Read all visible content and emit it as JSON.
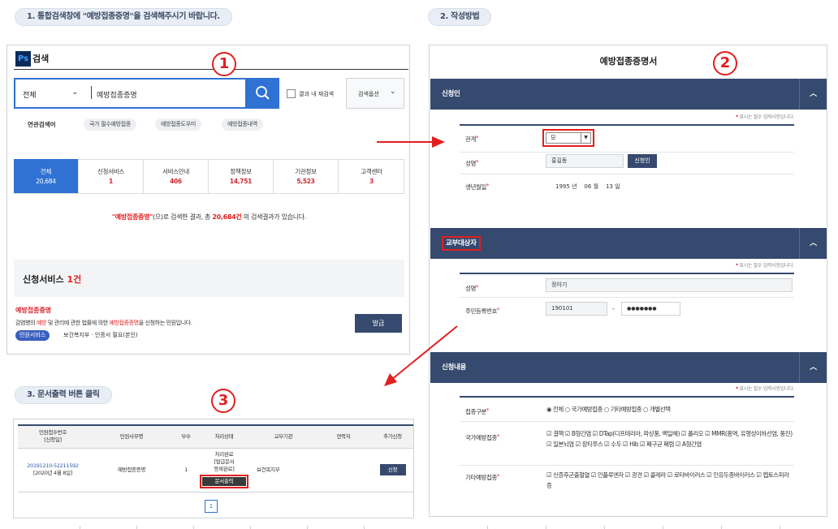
{
  "steps": {
    "step1": "1. 통합검색창에 \"예방접종증명\"을 검색해주시기 바랍니다.",
    "step2": "2. 작성방법",
    "step3": "3. 문서출력 버튼 클릭"
  },
  "markers": {
    "m1": "1",
    "m2": "2",
    "m3": "3"
  },
  "search": {
    "logo": "Ps",
    "title": "검색",
    "scope": "전체",
    "query": "예방접종증명",
    "in_result_label": "결과 내 재검색",
    "options_label": "검색옵션",
    "related_label": "연관검색어",
    "related_tags": [
      "국가 필수예방접종",
      "예방접종도우미",
      "예방접종내역"
    ],
    "tabs": [
      {
        "label": "전체",
        "count": "20,684"
      },
      {
        "label": "신청서비스",
        "count": "1"
      },
      {
        "label": "서비스안내",
        "count": "406"
      },
      {
        "label": "정책정보",
        "count": "14,751"
      },
      {
        "label": "기관정보",
        "count": "5,523"
      },
      {
        "label": "고객센터",
        "count": "3"
      }
    ],
    "result_q": "\"예방접종증명\"",
    "result_mid": "(으)로 검색한 결과, 총 ",
    "result_count": "20,684건",
    "result_tail": " 의 검색결과가 있습니다.",
    "section_title": "신청서비스 ",
    "section_count": "1건",
    "item_title": "예방접종증명",
    "item_desc_a": "감염병의 ",
    "item_desc_b": "예방",
    "item_desc_c": " 및 관리에 관한 법률에 의한 ",
    "item_desc_d": "예방접종증명",
    "item_desc_e": "을 신청하는 민원입니다.",
    "item_badge": "민원서비스",
    "item_meta": "보건복지부 · 인증서 필요(본인)",
    "issue_button": "발급"
  },
  "form": {
    "title": "예방접종증명서",
    "required_note_mark": "*",
    "required_note": " 표시는 필수 입력사항입니다.",
    "applicant": {
      "header": "신청인",
      "relation_label": "관계",
      "relation_value": "모",
      "name_label": "성명",
      "name_value": "홍길동",
      "applicant_button": "신청인",
      "birth_label": "생년월일",
      "birth_year": "1995",
      "year_unit": "년",
      "birth_month": "06",
      "month_unit": "월",
      "birth_day": "13",
      "day_unit": "일"
    },
    "target": {
      "header": "교부대상자",
      "name_label": "성명",
      "name_value": "정아기",
      "rrn_label": "주민등록번호",
      "rrn_front": "190101",
      "rrn_dash": "-",
      "rrn_back": "●●●●●●●"
    },
    "content": {
      "header": "신청내용",
      "type_label": "접종구분",
      "type_options": "◉ 전체 ○ 국가예방접종 ○ 기타예방접종 ○ 개별선택",
      "national_label": "국가예방접종",
      "national_items": "☑ 결핵 ☑ B형간염 ☑ DTap(디프테리아, 파상풍, 백일해) ☑ 폴리오 ☑ MMR(홍역, 유행성이하선염, 풍진) ☑ 일본뇌염 ☑ 장티푸스 ☑ 수두 ☑ Hib ☑ 폐구균 폐렴 ☑ A형간염",
      "other_label": "기타예방접종",
      "other_items": "☑ 신증후군출혈열 ☑ 인플루엔자 ☑ 광견 ☑ 콜레라 ☑ 로타바이러스 ☑ 인유두종바이러스 ☑ 렙토스피라증"
    }
  },
  "results_table": {
    "headers": [
      "민원접수번호\n[신청일]",
      "민원사무명",
      "부수",
      "처리상태",
      "교부기관",
      "연락처",
      "추가신청"
    ],
    "row": {
      "receipt_no": "20191210-52211592",
      "date": "[2020년 4월 8일]",
      "service": "예방접종증명",
      "copies": "1",
      "status": "처리완료\n[발급문서\n등록완료]",
      "print_button": "문서출력",
      "agency": "보건복지부",
      "contact": "",
      "add_button": "신청"
    },
    "page": "1"
  },
  "colors": {
    "accent_red": "#e21f1f",
    "navy": "#36496e",
    "blue": "#2f72d3"
  }
}
